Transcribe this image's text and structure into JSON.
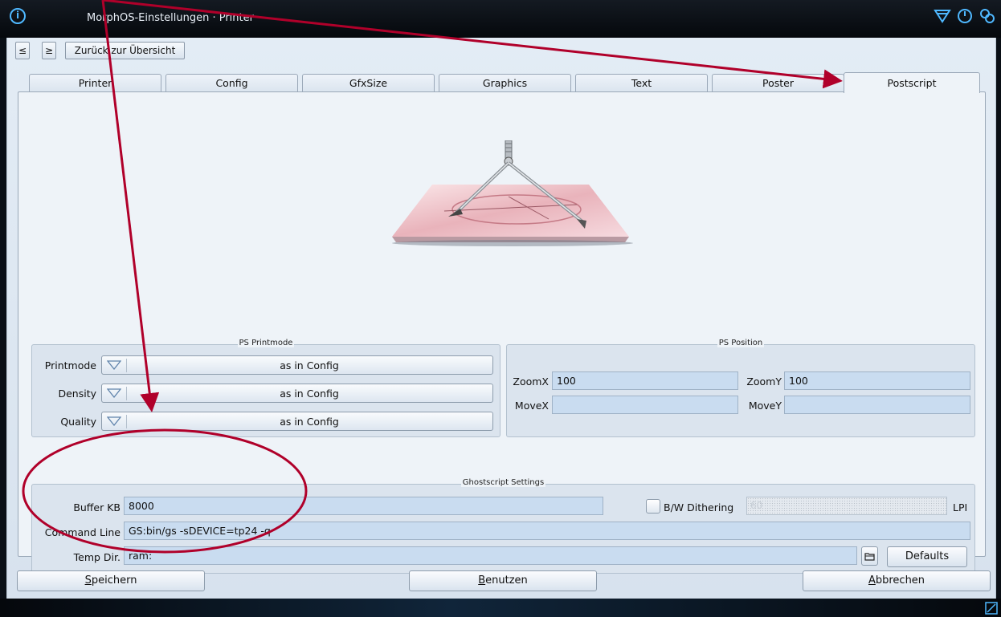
{
  "window": {
    "title": "MorphOS-Einstellungen · Printer",
    "app_icon_glyph": "i"
  },
  "nav": {
    "prev_label": "≤",
    "next_label": "≥",
    "back_label": "Zurück zur Übersicht"
  },
  "tabs": [
    {
      "label": "Printer"
    },
    {
      "label": "Config"
    },
    {
      "label": "GfxSize"
    },
    {
      "label": "Graphics"
    },
    {
      "label": "Text"
    },
    {
      "label": "Poster"
    },
    {
      "label": "Postscript",
      "active": true
    }
  ],
  "ps_printmode": {
    "title": "PS Printmode",
    "rows": [
      {
        "label": "Printmode",
        "value": "as in Config"
      },
      {
        "label": "Density",
        "value": "as in Config"
      },
      {
        "label": "Quality",
        "value": "as in Config"
      }
    ]
  },
  "ps_position": {
    "title": "PS Position",
    "zoomx_label": "ZoomX",
    "zoomx_value": "100",
    "zoomy_label": "ZoomY",
    "zoomy_value": "100",
    "movex_label": "MoveX",
    "movex_value": "",
    "movey_label": "MoveY",
    "movey_value": ""
  },
  "ghostscript": {
    "title": "Ghostscript Settings",
    "buffer_label": "Buffer KB",
    "buffer_value": "8000",
    "dithering_label": "B/W Dithering",
    "dithering_checked": false,
    "lpi_value": "60",
    "lpi_label": "LPI",
    "command_label": "Command Line",
    "command_value": "GS:bin/gs -sDEVICE=tp24 -q",
    "tempdir_label": "Temp Dir.",
    "tempdir_value": "ram:",
    "defaults_label": "Defaults"
  },
  "footer": {
    "save_label": "Speichern",
    "use_label": "Benutzen",
    "cancel_label": "Abbrechen"
  },
  "colors": {
    "annotation": "#b0002a",
    "accent": "#4fb8ff"
  },
  "icons": [
    "info-icon",
    "window-depth-icon",
    "window-iconify-icon",
    "window-close-icon",
    "folder-icon",
    "cycle-arrow-icon",
    "resize-grip-icon",
    "plotter-illustration"
  ]
}
